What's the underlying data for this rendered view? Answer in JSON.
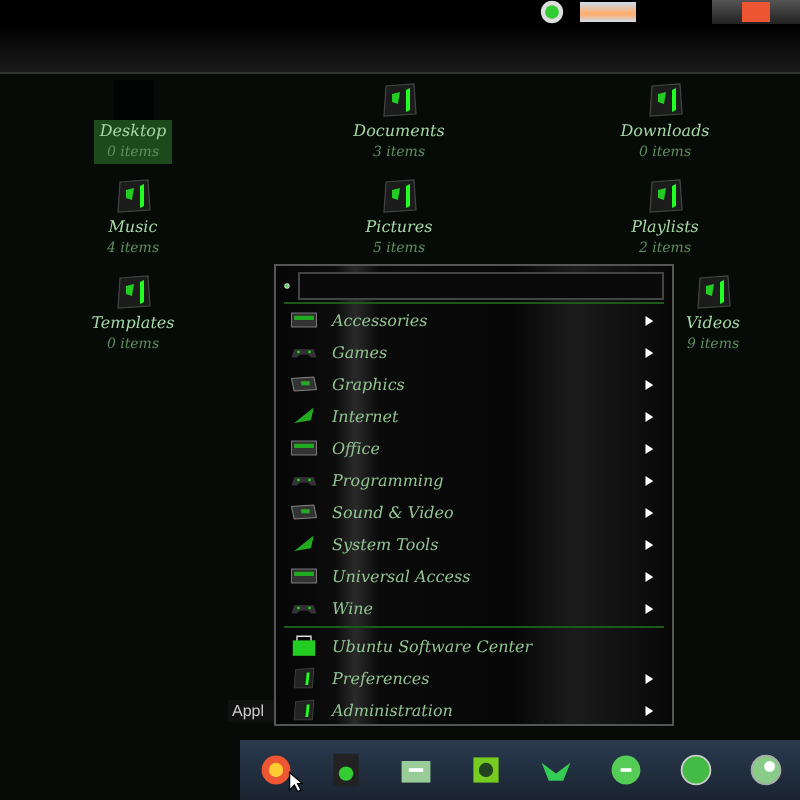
{
  "desktop": {
    "items": [
      {
        "label": "Desktop",
        "count": "0 items",
        "selected": true
      },
      {
        "label": "Documents",
        "count": "3 items",
        "selected": false
      },
      {
        "label": "Downloads",
        "count": "0 items",
        "selected": false
      },
      {
        "label": "Music",
        "count": "4 items",
        "selected": false
      },
      {
        "label": "Pictures",
        "count": "5 items",
        "selected": false
      },
      {
        "label": "Playlists",
        "count": "2 items",
        "selected": false
      },
      {
        "label": "Templates",
        "count": "0 items",
        "selected": false
      },
      {
        "label": "Videos",
        "count": "9 items",
        "selected": false
      }
    ]
  },
  "tooltip": "Appl",
  "menu": {
    "sections": [
      [
        {
          "label": "Accessories",
          "submenu": true
        },
        {
          "label": "Games",
          "submenu": true
        },
        {
          "label": "Graphics",
          "submenu": true
        },
        {
          "label": "Internet",
          "submenu": true
        },
        {
          "label": "Office",
          "submenu": true
        },
        {
          "label": "Programming",
          "submenu": true
        },
        {
          "label": "Sound & Video",
          "submenu": true
        },
        {
          "label": "System Tools",
          "submenu": true
        },
        {
          "label": "Universal Access",
          "submenu": true
        },
        {
          "label": "Wine",
          "submenu": true
        }
      ],
      [
        {
          "label": "Ubuntu Software Center",
          "submenu": false
        },
        {
          "label": "Preferences",
          "submenu": true
        },
        {
          "label": "Administration",
          "submenu": true
        }
      ]
    ]
  }
}
